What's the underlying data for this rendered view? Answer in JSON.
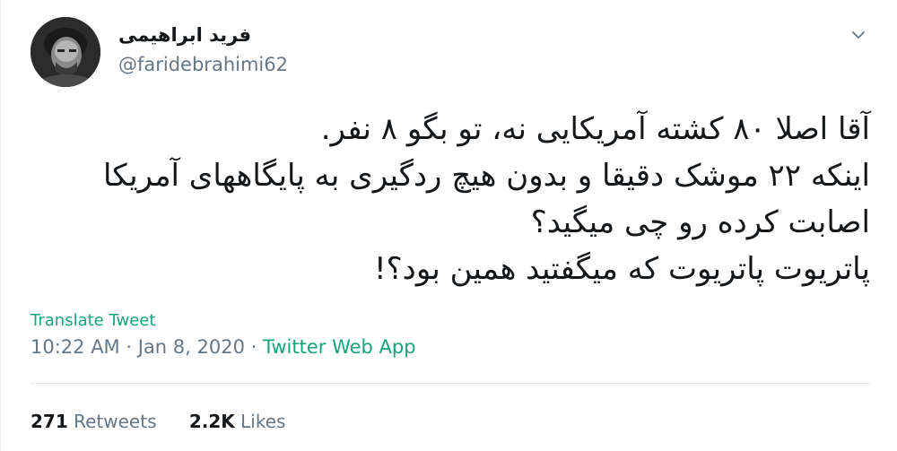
{
  "author": {
    "display_name": "فرید ابراهیمی",
    "username": "@faridebrahimi62"
  },
  "tweet": {
    "lines": [
      "آقا اصلا ۸۰ کشته آمریکایی نه، تو بگو ۸ نفر.",
      "اینکه ۲۲ موشک دقیقا و بدون هیچ ردگیری به پایگاههای آمریکا",
      "اصابت کرده رو چی میگید؟",
      "پاتریوت پاتریوت که میگفتید همین بود؟!"
    ]
  },
  "translate_label": "Translate Tweet",
  "meta": {
    "time": "10:22 AM",
    "separator": "·",
    "date": "Jan 8, 2020",
    "source": "Twitter Web App"
  },
  "stats": {
    "retweets_count": "271",
    "retweets_label": "Retweets",
    "likes_count": "2.2K",
    "likes_label": "Likes"
  },
  "icons": {
    "menu": "chevron-down-icon",
    "avatar": "avatar"
  },
  "colors": {
    "text": "#14171a",
    "secondary": "#657786",
    "link": "#16a37b",
    "divider": "#e1e8ed"
  }
}
